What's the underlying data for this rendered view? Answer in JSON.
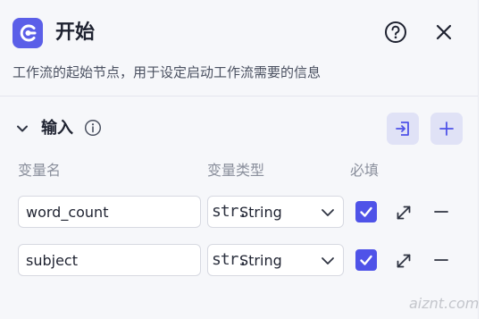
{
  "node": {
    "title": "开始",
    "description": "工作流的起始节点，用于设定启动工作流需要的信息",
    "icon": "play-circle-icon",
    "accent_color": "#5b5fe8"
  },
  "header": {
    "help_icon": "question-circle-icon",
    "close_icon": "close-icon"
  },
  "input_section": {
    "title": "输入",
    "info_icon": "info-circle-icon",
    "import_icon": "import-icon",
    "add_icon": "plus-icon",
    "columns": [
      "变量名",
      "变量类型",
      "必填"
    ],
    "variables": [
      {
        "name": "word_count",
        "type_icon": "str.",
        "type": "String",
        "required": true
      },
      {
        "name": "subject",
        "type_icon": "str.",
        "type": "String",
        "required": true
      }
    ]
  },
  "watermark": "aiznt.com"
}
